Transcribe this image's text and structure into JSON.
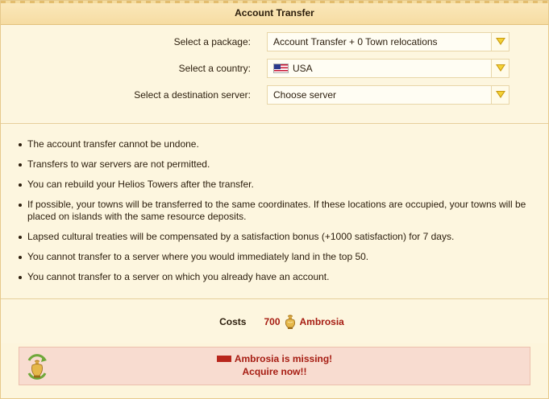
{
  "window": {
    "title": "Account Transfer"
  },
  "form": {
    "package": {
      "label": "Select a package:",
      "value": "Account Transfer + 0 Town relocations"
    },
    "country": {
      "label": "Select a country:",
      "value": "USA",
      "flag_icon": "usa-flag-icon"
    },
    "server": {
      "label": "Select a destination server:",
      "value": "Choose server"
    }
  },
  "rules": [
    "The account transfer cannot be undone.",
    "Transfers to war servers are not permitted.",
    "You can rebuild your Helios Towers after the transfer.",
    "If possible, your towns will be transferred to the same coordinates. If these locations are occupied, your towns will be placed on islands with the same resource deposits.",
    "Lapsed cultural treaties will be compensated by a satisfaction bonus (+1000 satisfaction) for 7 days.",
    "You cannot transfer to a server where you would immediately land in the top 50.",
    "You cannot transfer to a server on which you already have an account."
  ],
  "costs": {
    "label": "Costs",
    "amount": "700",
    "currency": "Ambrosia",
    "icon": "ambrosia-icon"
  },
  "missing": {
    "message": "Ambrosia is missing!",
    "link": "Acquire now!!",
    "icon": "ambrosia-refresh-icon"
  },
  "colors": {
    "accent_red": "#a61c12",
    "arrow_gold": "#f4d235",
    "panel_bg": "#fdf6df",
    "warning_bg": "#f8dcd0"
  }
}
